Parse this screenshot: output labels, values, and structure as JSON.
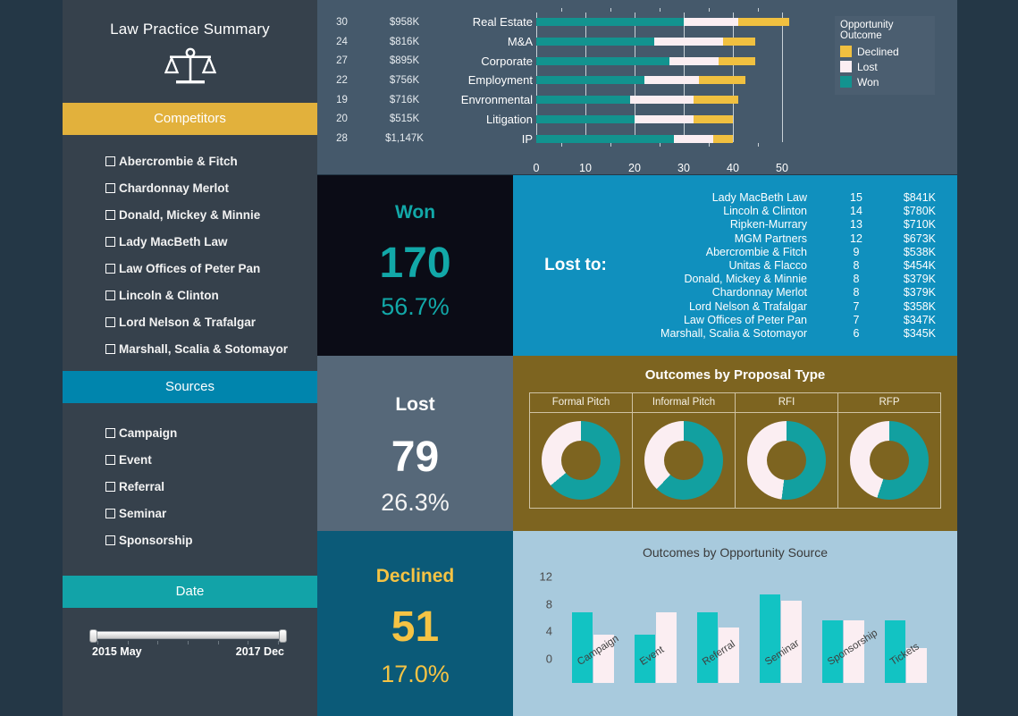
{
  "sidebar": {
    "title": "Law Practice Summary",
    "logo_icon": "scales-of-justice-icon",
    "competitors_header": "Competitors",
    "competitors": [
      "Abercrombie & Fitch",
      "Chardonnay Merlot",
      "Donald, Mickey & Minnie",
      "Lady MacBeth Law",
      "Law Offices of Peter Pan",
      "Lincoln & Clinton",
      "Lord Nelson & Trafalgar",
      "Marshall, Scalia & Sotomayor"
    ],
    "sources_header": "Sources",
    "sources": [
      "Campaign",
      "Event",
      "Referral",
      "Seminar",
      "Sponsorship"
    ],
    "date_header": "Date",
    "date_from": "2015 May",
    "date_to": "2017 Dec"
  },
  "kpis": [
    {
      "label": "Won",
      "value": "170",
      "percent": "56.7%"
    },
    {
      "label": "Lost",
      "value": "79",
      "percent": "26.3%"
    },
    {
      "label": "Declined",
      "value": "51",
      "percent": "17.0%"
    }
  ],
  "lost_to": {
    "caption": "Lost to:",
    "rows": [
      {
        "name": "Lady MacBeth Law",
        "count": "15",
        "amount": "$841K"
      },
      {
        "name": "Lincoln & Clinton",
        "count": "14",
        "amount": "$780K"
      },
      {
        "name": "Ripken-Murrary",
        "count": "13",
        "amount": "$710K"
      },
      {
        "name": "MGM Partners",
        "count": "12",
        "amount": "$673K"
      },
      {
        "name": "Abercrombie & Fitch",
        "count": "9",
        "amount": "$538K"
      },
      {
        "name": "Unitas & Flacco",
        "count": "8",
        "amount": "$454K"
      },
      {
        "name": "Donald, Mickey & Minnie",
        "count": "8",
        "amount": "$379K"
      },
      {
        "name": "Chardonnay Merlot",
        "count": "8",
        "amount": "$379K"
      },
      {
        "name": "Lord Nelson & Trafalgar",
        "count": "7",
        "amount": "$358K"
      },
      {
        "name": "Law Offices of Peter Pan",
        "count": "7",
        "amount": "$347K"
      },
      {
        "name": "Marshall, Scalia & Sotomayor",
        "count": "6",
        "amount": "$345K"
      }
    ]
  },
  "colors": {
    "won": "#12938f",
    "lost": "#fbeef2",
    "declined": "#f0c040",
    "accent_yellow": "#e2b13c",
    "accent_blue": "#0085ad",
    "accent_teal": "#12a3a8"
  },
  "chart_data": [
    {
      "type": "bar",
      "orientation": "horizontal",
      "stacked": true,
      "title": "",
      "xlabel": "",
      "ylabel": "",
      "xlim": [
        0,
        52
      ],
      "xticks": [
        0,
        10,
        20,
        30,
        40,
        50
      ],
      "grid": true,
      "legend": {
        "title": "Opportunity Outcome",
        "position": "top-right",
        "entries": [
          {
            "label": "Declined",
            "color": "#f0c040"
          },
          {
            "label": "Lost",
            "color": "#fbeef2"
          },
          {
            "label": "Won",
            "color": "#12938f"
          }
        ]
      },
      "categories": [
        "Real Estate",
        "M&A",
        "Corporate",
        "Employment",
        "Envronmental",
        "Litigation",
        "IP"
      ],
      "row_counts": [
        "30",
        "24",
        "27",
        "22",
        "19",
        "20",
        "28"
      ],
      "row_amounts": [
        "$958K",
        "$816K",
        "$895K",
        "$756K",
        "$716K",
        "$515K",
        "$1,147K"
      ],
      "series": [
        {
          "name": "Won",
          "values": [
            30,
            24,
            27,
            22,
            19,
            20,
            28
          ]
        },
        {
          "name": "Lost",
          "values": [
            11,
            14,
            10,
            11,
            13,
            12,
            8
          ]
        },
        {
          "name": "Declined",
          "values": [
            10.5,
            6.5,
            7.5,
            9.5,
            9,
            8,
            4
          ]
        }
      ]
    },
    {
      "type": "pie",
      "subtype": "donut-small-multiples",
      "title": "Outcomes by Proposal Type",
      "panels": [
        {
          "label": "Formal Pitch",
          "won_pct": 64,
          "lost_pct": 36
        },
        {
          "label": "Informal Pitch",
          "won_pct": 62,
          "lost_pct": 38
        },
        {
          "label": "RFI",
          "won_pct": 52,
          "lost_pct": 48
        },
        {
          "label": "RFP",
          "won_pct": 55,
          "lost_pct": 45
        }
      ],
      "colors": {
        "won": "#12a0a0",
        "lost": "#fbeef2"
      }
    },
    {
      "type": "bar",
      "orientation": "vertical",
      "grouped": true,
      "title": "Outcomes by Opportunity Source",
      "xlabel": "",
      "ylabel": "",
      "ylim": [
        0,
        13.5
      ],
      "yticks": [
        0,
        4,
        8,
        12
      ],
      "grid": false,
      "categories": [
        "Campaign",
        "Event",
        "Referral",
        "Seminar",
        "Sponsorship",
        "Tickets"
      ],
      "series": [
        {
          "name": "Won",
          "color": "#12c3c3",
          "values": [
            10.4,
            7.1,
            10.4,
            13.0,
            9.2,
            9.2
          ]
        },
        {
          "name": "Lost",
          "color": "#fbeef2",
          "values": [
            7.1,
            10.4,
            8.1,
            12.0,
            9.2,
            5.1
          ]
        }
      ]
    }
  ]
}
